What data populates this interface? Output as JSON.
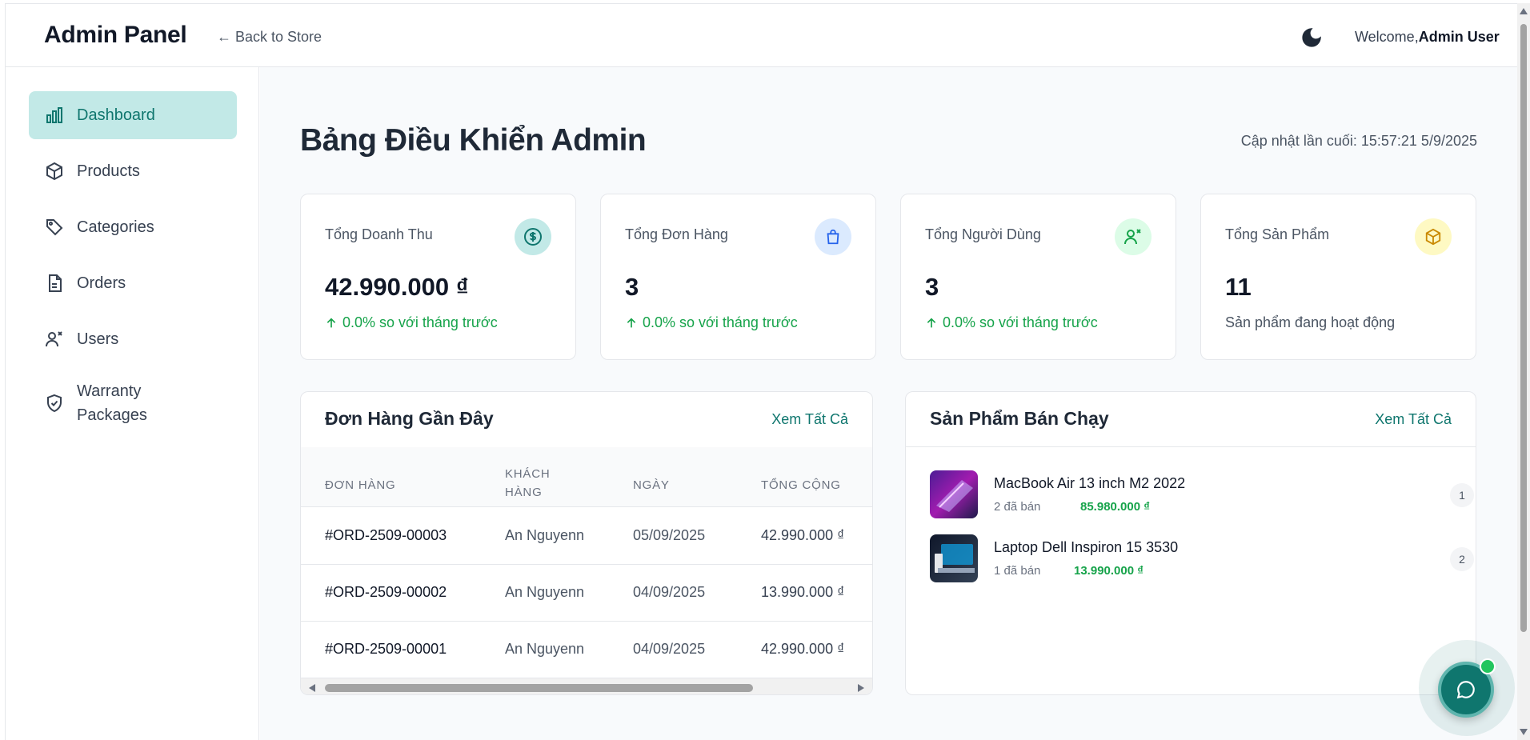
{
  "header": {
    "brand": "Admin Panel",
    "back_link": "← Back to Store",
    "welcome_prefix": "Welcome,",
    "user_name": "Admin User",
    "theme_icon": "moon-icon"
  },
  "sidebar": {
    "items": [
      {
        "label": "Dashboard",
        "icon": "bar-chart-icon",
        "active": true
      },
      {
        "label": "Products",
        "icon": "box-icon"
      },
      {
        "label": "Categories",
        "icon": "tag-icon"
      },
      {
        "label": "Orders",
        "icon": "file-icon"
      },
      {
        "label": "Users",
        "icon": "users-icon"
      },
      {
        "label": "Warranty\nPackages",
        "icon": "shield-check-icon"
      }
    ]
  },
  "main": {
    "title": "Bảng Điều Khiển Admin",
    "last_updated": "Cập nhật lần cuối: 15:57:21 5/9/2025",
    "stats": [
      {
        "title": "Tổng Doanh Thu",
        "value": "42.990.000 ₫",
        "sub": "0.0% so với tháng trước",
        "icon": "dollar-icon",
        "icon_bg": "#c2e9e7",
        "icon_color": "#0f766e"
      },
      {
        "title": "Tổng Đơn Hàng",
        "value": "3",
        "sub": "0.0% so với tháng trước",
        "icon": "shopping-bag-icon",
        "icon_bg": "#dbeafe",
        "icon_color": "#2563eb"
      },
      {
        "title": "Tổng Người Dùng",
        "value": "3",
        "sub": "0.0% so với tháng trước",
        "icon": "users-icon",
        "icon_bg": "#dcfce7",
        "icon_color": "#16a34a"
      },
      {
        "title": "Tổng Sản Phẩm",
        "value": "11",
        "sub": "Sản phẩm đang hoạt động",
        "icon": "box-icon",
        "icon_bg": "#fef9c3",
        "icon_color": "#ca8a04"
      }
    ],
    "recent_orders": {
      "title": "Đơn Hàng Gần Đây",
      "view_all": "Xem Tất Cả",
      "columns": [
        "ĐƠN HÀNG",
        "KHÁCH HÀNG",
        "NGÀY",
        "TỔNG CỘNG"
      ],
      "rows": [
        {
          "id": "#ORD-2509-00003",
          "customer": "An Nguyenn",
          "date": "05/09/2025",
          "total": "42.990.000 ₫"
        },
        {
          "id": "#ORD-2509-00002",
          "customer": "An Nguyenn",
          "date": "04/09/2025",
          "total": "13.990.000 ₫"
        },
        {
          "id": "#ORD-2509-00001",
          "customer": "An Nguyenn",
          "date": "04/09/2025",
          "total": "42.990.000 ₫"
        }
      ]
    },
    "top_products": {
      "title": "Sản Phẩm Bán Chạy",
      "view_all": "Xem Tất Cả",
      "items": [
        {
          "name": "MacBook Air 13 inch M2 2022",
          "sold": "2 đã bán",
          "price": "85.980.000 ₫",
          "rank": "1"
        },
        {
          "name": "Laptop Dell Inspiron 15 3530",
          "sold": "1 đã bán",
          "price": "13.990.000 ₫",
          "rank": "2"
        }
      ]
    }
  },
  "colors": {
    "accent": "#0f766e",
    "positive": "#16a34a",
    "active_nav_bg": "#c2e9e7"
  }
}
